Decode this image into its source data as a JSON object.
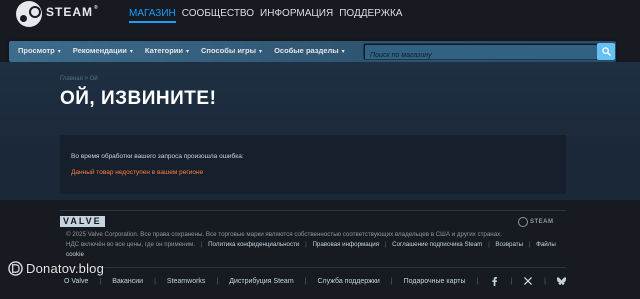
{
  "header": {
    "logo_text": "STEAM",
    "logo_mark": "®",
    "nav": [
      {
        "label": "МАГАЗИН",
        "active": true
      },
      {
        "label": "СООБЩЕСТВО",
        "active": false
      },
      {
        "label": "ИНФОРМАЦИЯ",
        "active": false
      },
      {
        "label": "ПОДДЕРЖКА",
        "active": false
      }
    ]
  },
  "storenav": {
    "items": [
      "Просмотр",
      "Рекомендации",
      "Категории",
      "Способы игры",
      "Особые разделы"
    ],
    "search_placeholder": "Поиск по магазину",
    "search_icon": "search-icon"
  },
  "content": {
    "breadcrumb": {
      "home": "Главная",
      "separator": ">",
      "current": "Ой"
    },
    "title": "ОЙ, ИЗВИНИТЕ!",
    "error_message": "Во время обработки вашего запроса произошла ошибка:",
    "error_reason": "Данный товар недоступен в вашем регионе"
  },
  "footer": {
    "valve_logo": "VALVE",
    "steam_logo": "STEAM",
    "legal_text": "© 2025 Valve Corporation. Все права сохранены. Все торговые марки являются собственностью соответствующих владельцев в США и других странах.",
    "vat_text": "НДС включён во все цены, где он применим.",
    "legal_links": [
      "Политика конфиденциальности",
      "Правовая информация",
      "Соглашение подписчика Steam",
      "Возвраты",
      "Файлы cookie"
    ],
    "links": [
      "О Valve",
      "Вакансии",
      "Steamworks",
      "Дистрибуция Steam",
      "Служба поддержки",
      "Подарочные карты"
    ],
    "social_icons": [
      "facebook-icon",
      "x-icon",
      "bluesky-icon"
    ]
  },
  "watermark": {
    "text": "Donatov.blog"
  },
  "colors": {
    "accent": "#1a9fff",
    "background": "#1b2838",
    "header_bg": "#171a21",
    "error_text": "#ff7b3f",
    "search_button": "#66c0f4"
  }
}
